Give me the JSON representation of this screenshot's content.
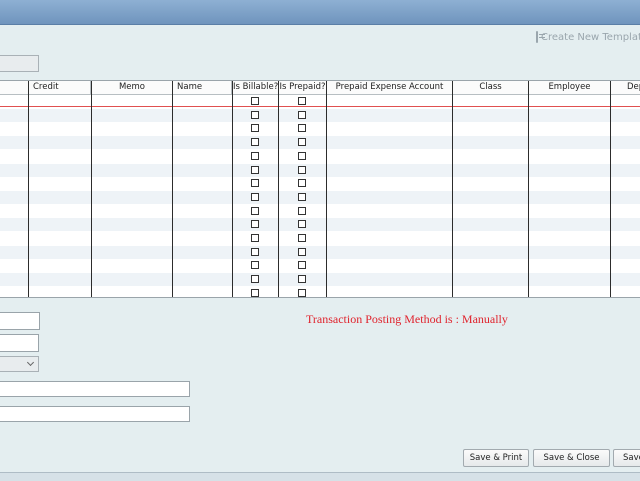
{
  "toolbar": {
    "create_template_label": "Create New Template"
  },
  "grid": {
    "columns": [
      "",
      "Credit",
      "Memo",
      "Name",
      "Is Billable?",
      "Is Prepaid?",
      "Prepaid Expense Account",
      "Class",
      "Employee",
      "Dep"
    ]
  },
  "status": {
    "posting_method": "Transaction Posting Method is : Manually"
  },
  "buttons": {
    "save_print": "Save & Print",
    "save_close": "Save & Close",
    "save_new": "Save"
  }
}
